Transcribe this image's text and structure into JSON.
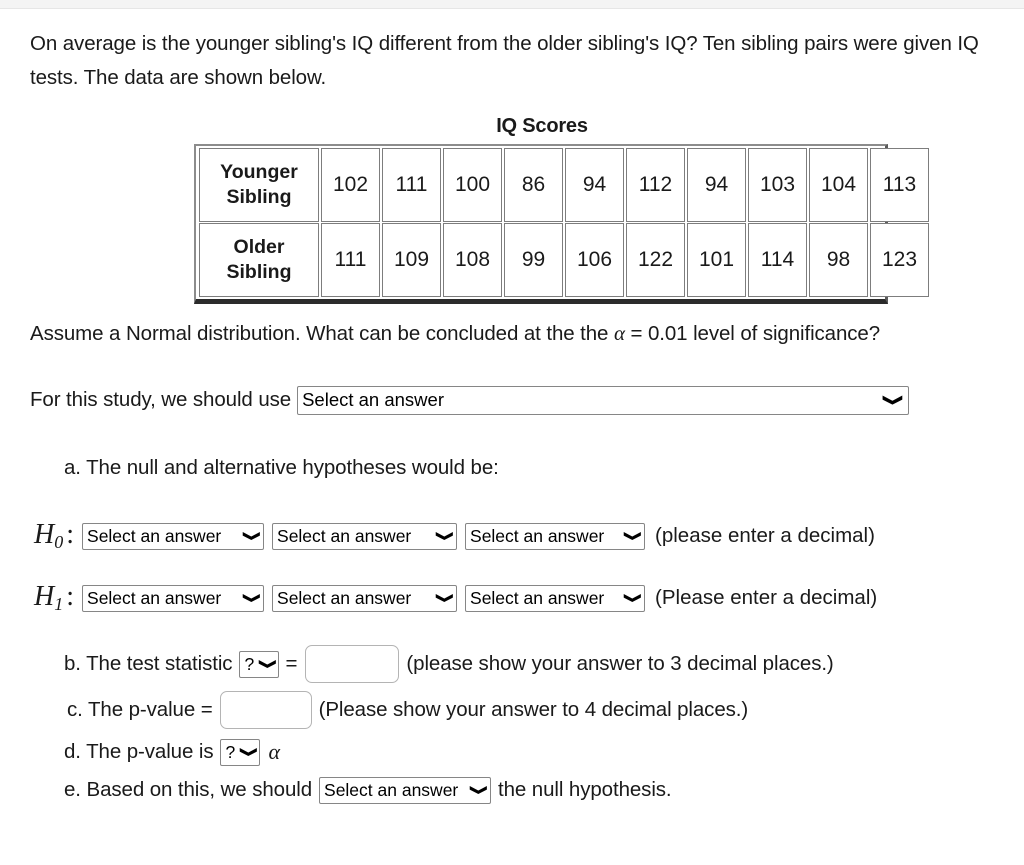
{
  "intro": {
    "text": "On average is the younger sibling's IQ different from the older sibling's IQ? Ten sibling pairs were given IQ tests. The data are shown below."
  },
  "table": {
    "title": "IQ Scores",
    "rows": [
      {
        "header_line1": "Younger",
        "header_line2": "Sibling",
        "values": [
          "102",
          "111",
          "100",
          "86",
          "94",
          "112",
          "94",
          "103",
          "104",
          "113"
        ]
      },
      {
        "header_line1": "Older",
        "header_line2": "Sibling",
        "values": [
          "111",
          "109",
          "108",
          "99",
          "106",
          "122",
          "101",
          "114",
          "98",
          "123"
        ]
      }
    ]
  },
  "assume": {
    "part1": "Assume a Normal distribution.  What can be concluded at the the ",
    "alpha": "α",
    "part2": " = 0.01 level of significance?"
  },
  "study": {
    "label": "For this study, we should use",
    "select_value": "Select an answer"
  },
  "item_a": {
    "text": "a. The null and alternative hypotheses would be:"
  },
  "hypotheses": {
    "h0": {
      "symbol": "H",
      "subscript": "0",
      "colon": ":",
      "select1": "Select an answer",
      "select2": "Select an answer",
      "select3": "Select an answer",
      "note": "(please enter a decimal)"
    },
    "h1": {
      "symbol": "H",
      "subscript": "1",
      "colon": ":",
      "select1": "Select an answer",
      "select2": "Select an answer",
      "select3": "Select an answer",
      "note": "(Please enter a decimal)"
    }
  },
  "item_b": {
    "label": "b. The test statistic",
    "select_value": "?",
    "equals": "=",
    "input_value": "",
    "note": "(please show your answer to 3 decimal places.)"
  },
  "item_c": {
    "label": "c. The p-value =",
    "input_value": "",
    "note": "(Please show your answer to 4 decimal places.)"
  },
  "item_d": {
    "label": "d. The p-value is",
    "select_value": "?",
    "alpha": "α"
  },
  "item_e": {
    "label_before": "e. Based on this, we should",
    "select_value": "Select an answer",
    "label_after": "the null hypothesis."
  },
  "icons": {
    "chevron_down": "⌄"
  }
}
